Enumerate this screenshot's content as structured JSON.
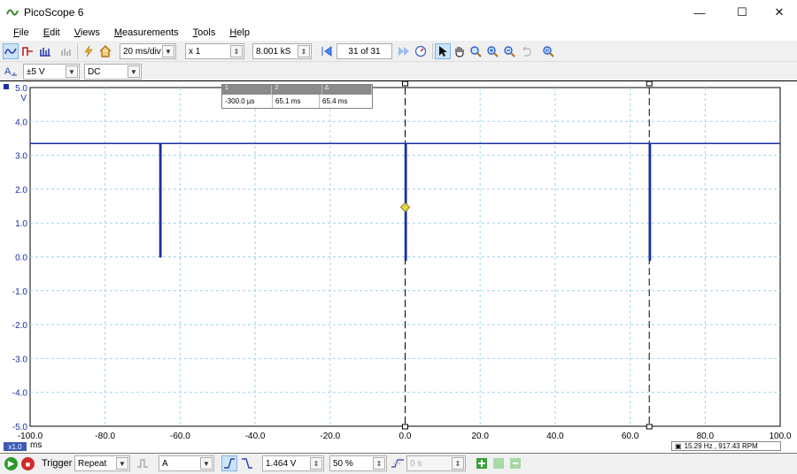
{
  "window": {
    "title": "PicoScope 6",
    "minimize": "—",
    "maximize": "☐",
    "close": "✕"
  },
  "menu": [
    {
      "ul": "F",
      "rest": "ile"
    },
    {
      "ul": "E",
      "rest": "dit"
    },
    {
      "ul": "V",
      "rest": "iews"
    },
    {
      "ul": "M",
      "rest": "easurements"
    },
    {
      "ul": "T",
      "rest": "ools"
    },
    {
      "ul": "H",
      "rest": "elp"
    }
  ],
  "toolbar": {
    "timebase": "20 ms/div",
    "zoom": "x 1",
    "samples": "8.001 kS",
    "buffer": "31 of 31"
  },
  "channel": {
    "name": "A",
    "range": "±5 V",
    "coupling": "DC"
  },
  "measurements": {
    "headers": [
      "1",
      "2",
      "Δ"
    ],
    "values": [
      "-300.0 µs",
      "65.1 ms",
      "65.4 ms"
    ]
  },
  "axis": {
    "y_unit": "V",
    "x_unit": "ms",
    "zoom_box": "x1.0",
    "y_ticks": [
      "5.0",
      "4.0",
      "3.0",
      "2.0",
      "1.0",
      "0.0",
      "-1.0",
      "-2.0",
      "-3.0",
      "-4.0",
      "-5.0"
    ],
    "x_ticks": [
      "-100.0",
      "-80.0",
      "-60.0",
      "-40.0",
      "-20.0",
      "0.0",
      "20.0",
      "40.0",
      "60.0",
      "80.0",
      "100.0"
    ]
  },
  "frequency_readout": "15.29 Hz , 917.43 RPM",
  "trigger": {
    "label": "Trigger",
    "mode": "Repeat",
    "source": "A",
    "level": "1.464 V",
    "pretrigger": "50 %",
    "delay": "0 s"
  },
  "colors": {
    "trace": "#1a2fa0",
    "grid": "#9fd3e8",
    "trigger_marker": "#e6d84a"
  },
  "chart_data": {
    "type": "line",
    "xlabel": "ms",
    "ylabel": "V",
    "xlim": [
      -100,
      100
    ],
    "ylim": [
      -5,
      5
    ],
    "grid": true,
    "series": [
      {
        "x": [
          -100,
          -65.4,
          -65.4,
          -65.1,
          -65.1,
          0,
          0,
          0.3,
          0.3,
          65.1,
          65.1,
          65.4,
          65.4,
          100
        ],
        "y": [
          3.35,
          3.35,
          0.0,
          0.0,
          3.35,
          3.35,
          -0.1,
          -0.1,
          3.35,
          3.35,
          -0.1,
          -0.1,
          3.35,
          3.35
        ]
      }
    ],
    "rulers_x": [
      0.0,
      65.1
    ],
    "trigger_point": {
      "x": 0.0,
      "y": 1.464
    }
  }
}
